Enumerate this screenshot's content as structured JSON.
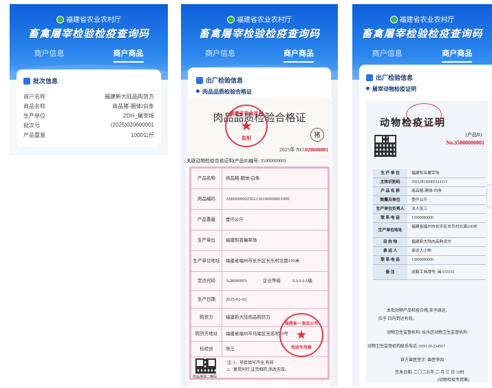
{
  "org": "福建省农业农村厅",
  "title": "畜禽屠宰检验检疫查询码",
  "tabs": [
    "商户信息",
    "商户商品"
  ],
  "batch": {
    "heading": "批次信息",
    "rows": [
      {
        "k": "商户名称",
        "v": "福建新大陆品购货方"
      },
      {
        "k": "商品名称",
        "v": "商品猪-胴体/白条"
      },
      {
        "k": "生产单位",
        "v": "ZDH_屠宰场"
      },
      {
        "k": "批次号",
        "v": "(2025)020600001"
      },
      {
        "k": "产品重量",
        "v": "1000公斤"
      }
    ]
  },
  "factory_heading": "出厂检验信息",
  "meat_cert_label": "肉品品质检验合格证",
  "animal_cert_label": "屠宰动物检疫证明",
  "meat_cert": {
    "title": "肉品品质检验合格证",
    "pig_mark": "猪",
    "no_prefix": "2025年 NO.",
    "no_value": "020600001",
    "related": "关联动物检疫合格证明(产品B)编号: 35000000001",
    "rows": [
      {
        "k": "产品名称",
        "v": "商品猪-胴体/白条"
      },
      {
        "k": "肉品编码",
        "v": "A000000002502130100000001000"
      },
      {
        "k": "产品重量",
        "v": "壹仟公斤"
      },
      {
        "k": "生产单位",
        "v": "福建知名屠宰场"
      },
      {
        "k": "生产单位地址",
        "v": "福建省福州市长乐区长乐村北面100米"
      },
      {
        "k": "定点代码",
        "v": "A28080001"
      },
      {
        "k": "生产日期",
        "v": "2025-02-03"
      },
      {
        "k": "购货方",
        "v": "福建新大陆肉品购货方"
      },
      {
        "k": "购货方地址",
        "v": "福建省福州市马尾区无名村10号"
      },
      {
        "k": "检验员",
        "v": "张三"
      }
    ],
    "grade_label": "企业等级",
    "grade_value": "AAAAA级",
    "notes": [
      "注: 1、项目填写齐全,有效",
      "2、复货同行,证货相符,涂改无效。"
    ],
    "qr_caption": "肉品溯源二维码",
    "stamp_org": "福建省农业农村",
    "stamp_sub": "监制",
    "stamp2": "福建省××食品公司",
    "stamp2_sub": "检验专用章"
  },
  "animal_cert": {
    "title": "动物检疫证明",
    "sub": "(产品B)",
    "no": "No.35000000001",
    "rows": [
      {
        "k": "生 产 单 位",
        "v": "福建知名屠宰场"
      },
      {
        "k": "主体识别码",
        "v": "350128199903124111"
      },
      {
        "k": "产 品 名 称",
        "v": "商品猪-胴体/白条"
      },
      {
        "k": "数量及单位",
        "v": "壹仟公斤"
      },
      {
        "k": "生产单位负责人",
        "v": "法人张三"
      },
      {
        "k": "联 系 电 话",
        "v": "13900000000"
      },
      {
        "k": "生产单位地址",
        "v": "福建省福州市长乐区长乐村北面100米"
      },
      {
        "k": "目 的 地",
        "v": "福建新大陆肉品购货方"
      },
      {
        "k": "承 运 人",
        "v": "承运人小陈"
      },
      {
        "k": "联 系 电 话",
        "v": "13800000000"
      },
      {
        "k": "备 注",
        "v": "运载工具牌号: 闽A55555"
      }
    ],
    "note1": "本批动物产品检疫合格,准予调运,",
    "note2": "应于    日内到达有效。",
    "agency": "动物卫生监督机构: 长乐区动物卫生监督机构",
    "phone": "动物卫生监督机构联系电话: 0591-81234567",
    "vet": "官方兽医签字: 兽医李四",
    "date": "签发日期: 二〇二五年 二 月 三 日 10时",
    "stamp_note": "(动物检疫专用章)"
  }
}
